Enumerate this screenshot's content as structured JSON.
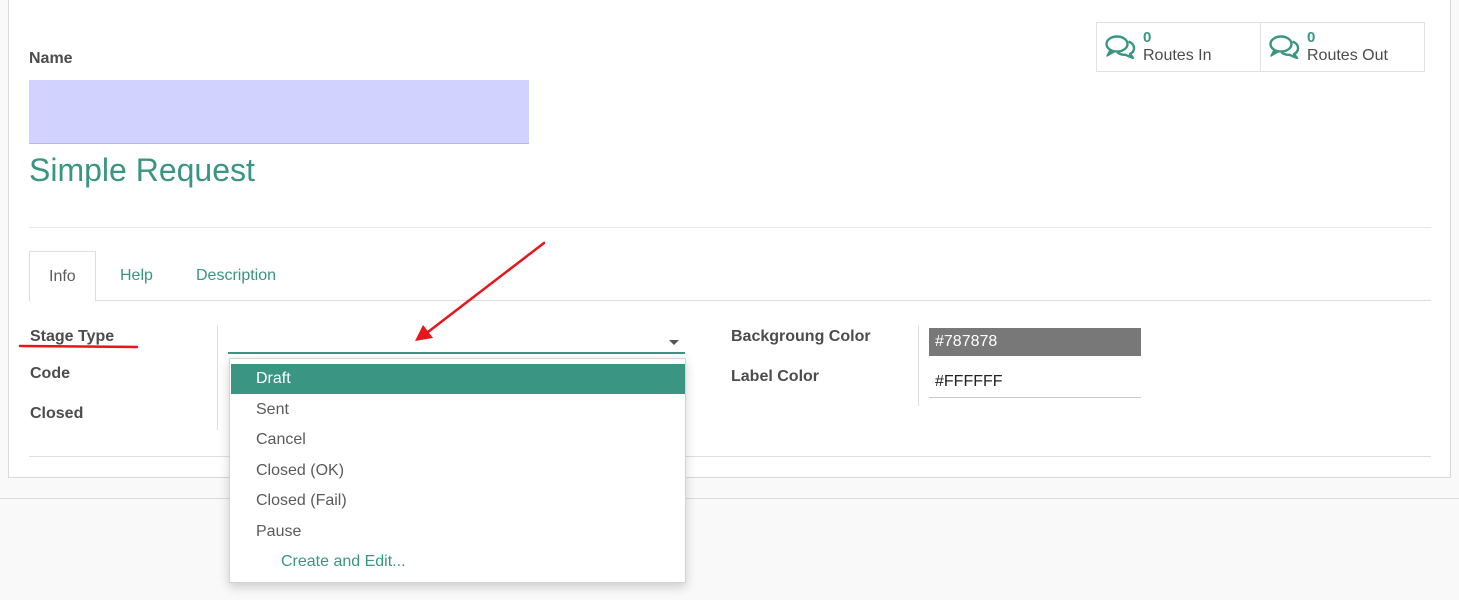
{
  "smart_buttons": [
    {
      "count": "0",
      "label": "Routes In",
      "icon": "comments-icon"
    },
    {
      "count": "0",
      "label": "Routes Out",
      "icon": "comments-icon"
    }
  ],
  "form": {
    "name_label": "Name",
    "name_value": "",
    "title": "Simple Request"
  },
  "tabs": [
    {
      "label": "Info",
      "active": true
    },
    {
      "label": "Help"
    },
    {
      "label": "Description"
    }
  ],
  "fields": {
    "stage_type_label": "Stage Type",
    "code_label": "Code",
    "closed_label": "Closed",
    "bg_color_label": "Backgroung Color",
    "bg_color_value": "#787878",
    "label_color_label": "Label Color",
    "label_color_value": "#FFFFFF"
  },
  "dropdown": {
    "options": [
      "Draft",
      "Sent",
      "Cancel",
      "Closed (OK)",
      "Closed (Fail)",
      "Pause"
    ],
    "selected": "Draft",
    "create_label": "Create and Edit..."
  },
  "colors": {
    "accent": "#3a9583",
    "name_bg": "#d2d2fe",
    "annotation": "#e8161b"
  }
}
